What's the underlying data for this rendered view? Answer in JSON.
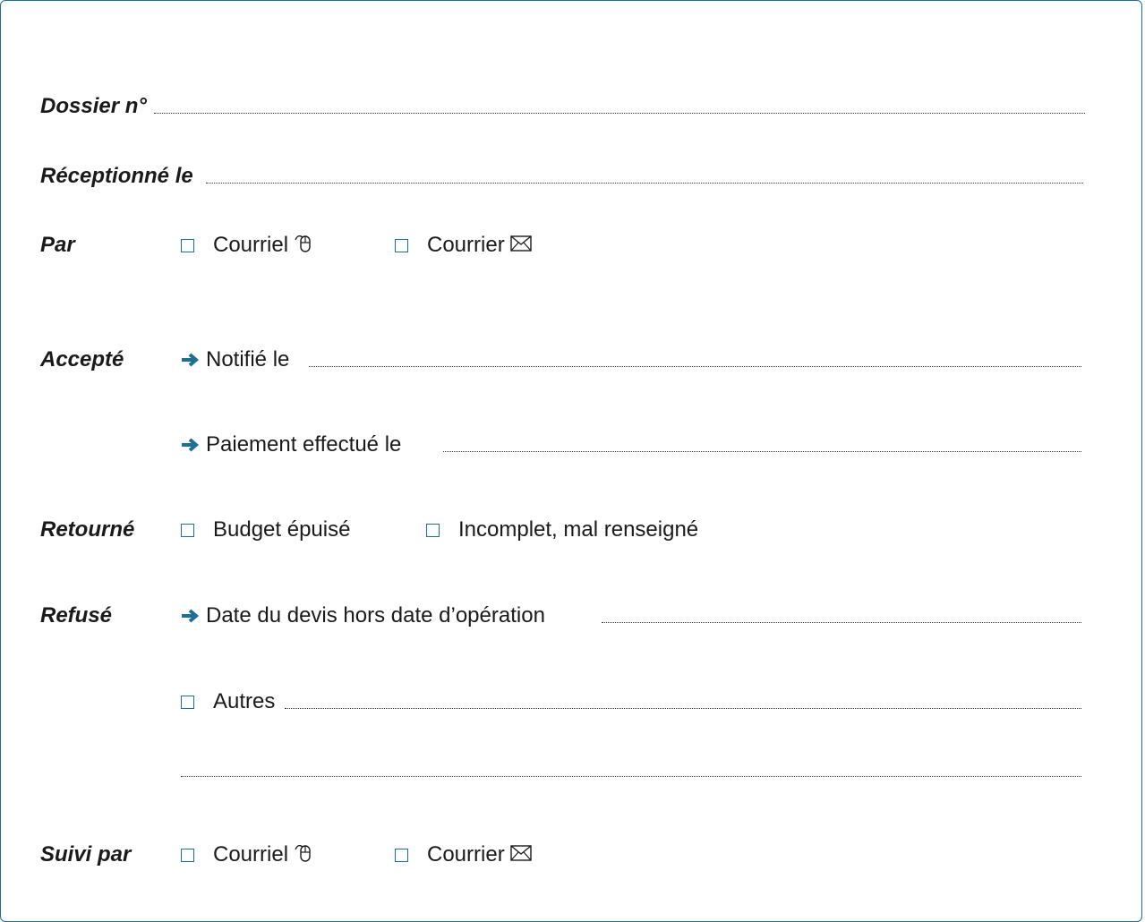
{
  "dossier": {
    "label": "Dossier n°"
  },
  "receptionne": {
    "label": "Réceptionné le"
  },
  "par": {
    "label": "Par",
    "option1": "Courriel",
    "option2": "Courrier"
  },
  "accepte": {
    "label": "Accepté",
    "notifie": "Notifié le",
    "paiement": "Paiement effectué le"
  },
  "retourne": {
    "label": "Retourné",
    "option1": "Budget épuisé",
    "option2": "Incomplet, mal renseigné"
  },
  "refuse": {
    "label": "Refusé",
    "date_devis": "Date du devis hors date d’opération",
    "autres": "Autres"
  },
  "suivi": {
    "label": "Suivi par",
    "option1": "Courriel",
    "option2": "Courrier"
  },
  "colors": {
    "border": "#1f6e94",
    "checkbox": "#1f6e94",
    "arrow": "#1f6e94"
  },
  "icons": {
    "email": "mouse-icon",
    "mail": "envelope-icon",
    "bullet": "arrow-right-icon"
  }
}
